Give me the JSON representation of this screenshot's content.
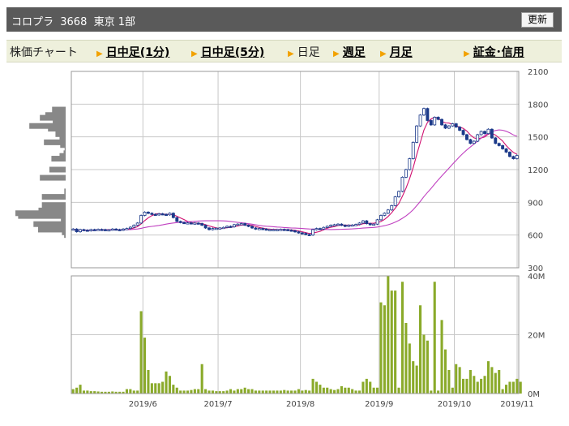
{
  "header": {
    "title": "コロプラ  3668  東京 1部",
    "refresh_label": "更新"
  },
  "menu": {
    "label": "株価チャート",
    "items": [
      {
        "label": "日中足(1分)",
        "link": true
      },
      {
        "label": "日中足(5分)",
        "link": true
      },
      {
        "label": "日足",
        "link": false
      },
      {
        "label": "週足",
        "link": true
      },
      {
        "label": "月足",
        "link": true
      },
      {
        "label": "証金･信用",
        "link": true
      }
    ]
  },
  "chart_data": [
    {
      "type": "candlestick",
      "x_ticks": [
        "2019/6",
        "2019/7",
        "2019/8",
        "2019/9",
        "2019/10",
        "2019/11"
      ],
      "ylim": [
        300,
        2100
      ],
      "yticks": [
        "2100",
        "1800",
        "1500",
        "1200",
        "900",
        "600",
        "300"
      ],
      "colors": {
        "up": "#ffffff",
        "down": "#1c3a8a",
        "ma_short": "#d01070",
        "ma_long": "#c040c0",
        "grid": "#c8c8c8",
        "profile": "#888888"
      },
      "close": [
        655,
        630,
        650,
        645,
        640,
        650,
        648,
        652,
        650,
        645,
        648,
        655,
        650,
        645,
        655,
        660,
        672,
        690,
        710,
        780,
        810,
        800,
        790,
        785,
        795,
        790,
        785,
        800,
        760,
        725,
        715,
        710,
        712,
        705,
        710,
        705,
        690,
        665,
        650,
        660,
        662,
        665,
        670,
        680,
        675,
        695,
        700,
        705,
        690,
        680,
        665,
        655,
        660,
        655,
        650,
        650,
        650,
        650,
        652,
        650,
        645,
        640,
        630,
        620,
        615,
        605,
        600,
        650,
        660,
        655,
        670,
        680,
        690,
        695,
        700,
        690,
        680,
        690,
        692,
        697,
        710,
        730,
        705,
        695,
        700,
        740,
        780,
        800,
        830,
        870,
        950,
        1000,
        1130,
        1200,
        1300,
        1450,
        1600,
        1700,
        1760,
        1650,
        1610,
        1680,
        1660,
        1610,
        1580,
        1600,
        1620,
        1590,
        1560,
        1520,
        1475,
        1440,
        1460,
        1520,
        1550,
        1530,
        1570,
        1490,
        1440,
        1420,
        1390,
        1360,
        1320,
        1300,
        1330
      ],
      "open": [
        650,
        655,
        630,
        650,
        645,
        640,
        650,
        648,
        652,
        650,
        645,
        648,
        655,
        650,
        645,
        655,
        660,
        672,
        690,
        710,
        780,
        810,
        800,
        790,
        785,
        795,
        790,
        785,
        800,
        760,
        725,
        715,
        710,
        712,
        705,
        710,
        705,
        690,
        665,
        650,
        660,
        662,
        665,
        670,
        680,
        675,
        695,
        700,
        705,
        690,
        680,
        665,
        655,
        660,
        655,
        650,
        650,
        650,
        650,
        652,
        650,
        645,
        640,
        630,
        620,
        615,
        605,
        600,
        650,
        660,
        655,
        670,
        680,
        690,
        695,
        700,
        690,
        680,
        690,
        692,
        697,
        710,
        730,
        705,
        695,
        700,
        740,
        780,
        800,
        830,
        870,
        950,
        1000,
        1130,
        1200,
        1300,
        1450,
        1600,
        1700,
        1760,
        1650,
        1610,
        1680,
        1660,
        1610,
        1580,
        1600,
        1620,
        1590,
        1560,
        1520,
        1475,
        1440,
        1460,
        1520,
        1550,
        1530,
        1570,
        1490,
        1440,
        1420,
        1390,
        1360,
        1320,
        1300
      ],
      "volume_ylim": [
        0,
        40
      ],
      "volume_unit": "M",
      "volume_ticks": [
        "40M",
        "20M",
        "0M"
      ],
      "volume": [
        1.5,
        2,
        3,
        1,
        1,
        0.8,
        0.8,
        0.7,
        0.6,
        0.6,
        0.6,
        0.7,
        0.6,
        0.6,
        0.6,
        1.5,
        1.5,
        1,
        1,
        28,
        19,
        8,
        3.5,
        3.5,
        3.5,
        4,
        7.5,
        6,
        3,
        2,
        1,
        1,
        1,
        1.2,
        1.5,
        1.5,
        10,
        1.5,
        1,
        1,
        0.8,
        0.8,
        0.8,
        1,
        1.5,
        1,
        1.5,
        1.5,
        2,
        1.5,
        1.5,
        1,
        1,
        1,
        1,
        1,
        1,
        1,
        1,
        1.2,
        1,
        1,
        1,
        1.5,
        1,
        1.2,
        1,
        5,
        4,
        3,
        2,
        2,
        1.5,
        1.2,
        1.5,
        2.5,
        2,
        2,
        1.5,
        1,
        1,
        4,
        5,
        4,
        2,
        2,
        31,
        30,
        40,
        35,
        35,
        2,
        38,
        24,
        17,
        11,
        9.5,
        30,
        20,
        18,
        1,
        38,
        1,
        25,
        15,
        8,
        2,
        10,
        9,
        5,
        5,
        8,
        6,
        4,
        5,
        6,
        11,
        9,
        7,
        8,
        1.5,
        3,
        4,
        4,
        5,
        4
      ]
    }
  ]
}
